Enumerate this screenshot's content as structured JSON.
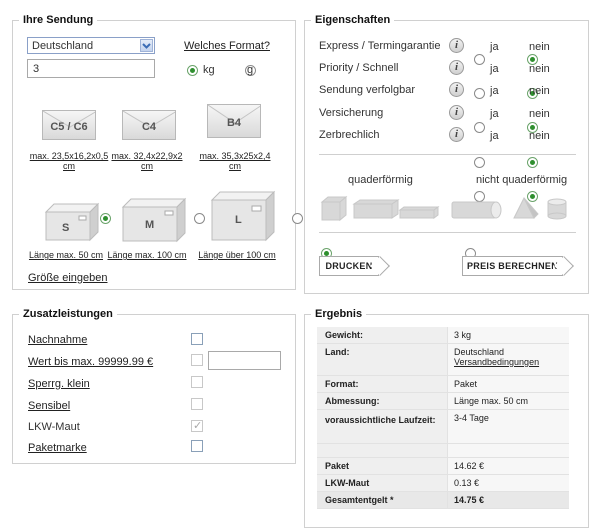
{
  "sendung": {
    "legend": "Ihre Sendung",
    "country": "Deutschland",
    "weight": "3",
    "format_link": "Welches Format?",
    "unit_kg": "kg",
    "unit_g": "g",
    "selected_unit": "kg",
    "envelopes": [
      {
        "label": "C5 / C6",
        "size": "max. 23,5x16,2x0,5 cm"
      },
      {
        "label": "C4",
        "size": "max. 32,4x22,9x2 cm"
      },
      {
        "label": "B4",
        "size": "max. 35,3x25x2,4 cm"
      }
    ],
    "boxes": [
      {
        "label": "S",
        "size": "Länge max. 50 cm",
        "selected": true
      },
      {
        "label": "M",
        "size": "Länge max. 100 cm",
        "selected": false
      },
      {
        "label": "L",
        "size": "Länge über 100 cm",
        "selected": false
      }
    ],
    "custom_size_link": "Größe eingeben"
  },
  "eigenschaften": {
    "legend": "Eigenschaften",
    "yes": "ja",
    "no": "nein",
    "options": [
      {
        "label": "Express / Termingarantie",
        "value": "nein"
      },
      {
        "label": "Priority / Schnell",
        "value": "nein"
      },
      {
        "label": "Sendung verfolgbar",
        "value": "nein"
      },
      {
        "label": "Versicherung",
        "value": "nein"
      },
      {
        "label": "Zerbrechlich",
        "value": "nein"
      }
    ],
    "shape_cuboid": "quaderförmig",
    "shape_non_cuboid": "nicht quaderförmig",
    "selected_shape": "quaderförmig",
    "print_button": "DRUCKEN",
    "calc_button": "PREIS BERECHNEN"
  },
  "zusatz": {
    "legend": "Zusatzleistungen",
    "items": [
      {
        "label": "Nachnahme",
        "checked": false,
        "enabled": true
      },
      {
        "label": "Wert bis max. 99999.99 €",
        "checked": false,
        "enabled": false,
        "input_value": ""
      },
      {
        "label": "Sperrg. klein",
        "checked": false,
        "enabled": false
      },
      {
        "label": "Sensibel",
        "checked": false,
        "enabled": false
      },
      {
        "label": "LKW-Maut",
        "checked": true,
        "enabled": false
      },
      {
        "label": "Paketmarke",
        "checked": false,
        "enabled": true
      }
    ]
  },
  "ergebnis": {
    "legend": "Ergebnis",
    "gewicht_label": "Gewicht:",
    "gewicht_value": "3 kg",
    "land_label": "Land:",
    "land_value": "Deutschland",
    "land_link": "Versandbedingungen",
    "format_label": "Format:",
    "format_value": "Paket",
    "abmessung_label": "Abmessung:",
    "abmessung_value": "Länge max. 50 cm",
    "laufzeit_label": "voraussichtliche Laufzeit:",
    "laufzeit_value": "3-4 Tage",
    "paket_label": "Paket",
    "paket_value": "14.62 €",
    "maut_label": "LKW-Maut",
    "maut_value": "0.13 €",
    "total_label": "Gesamtentgelt *",
    "total_value": "14.75 €"
  },
  "colors": {
    "accent_radio": "#2f8f2f",
    "border": "#d0d0d0",
    "select_arrow": "#3b6cb5"
  }
}
